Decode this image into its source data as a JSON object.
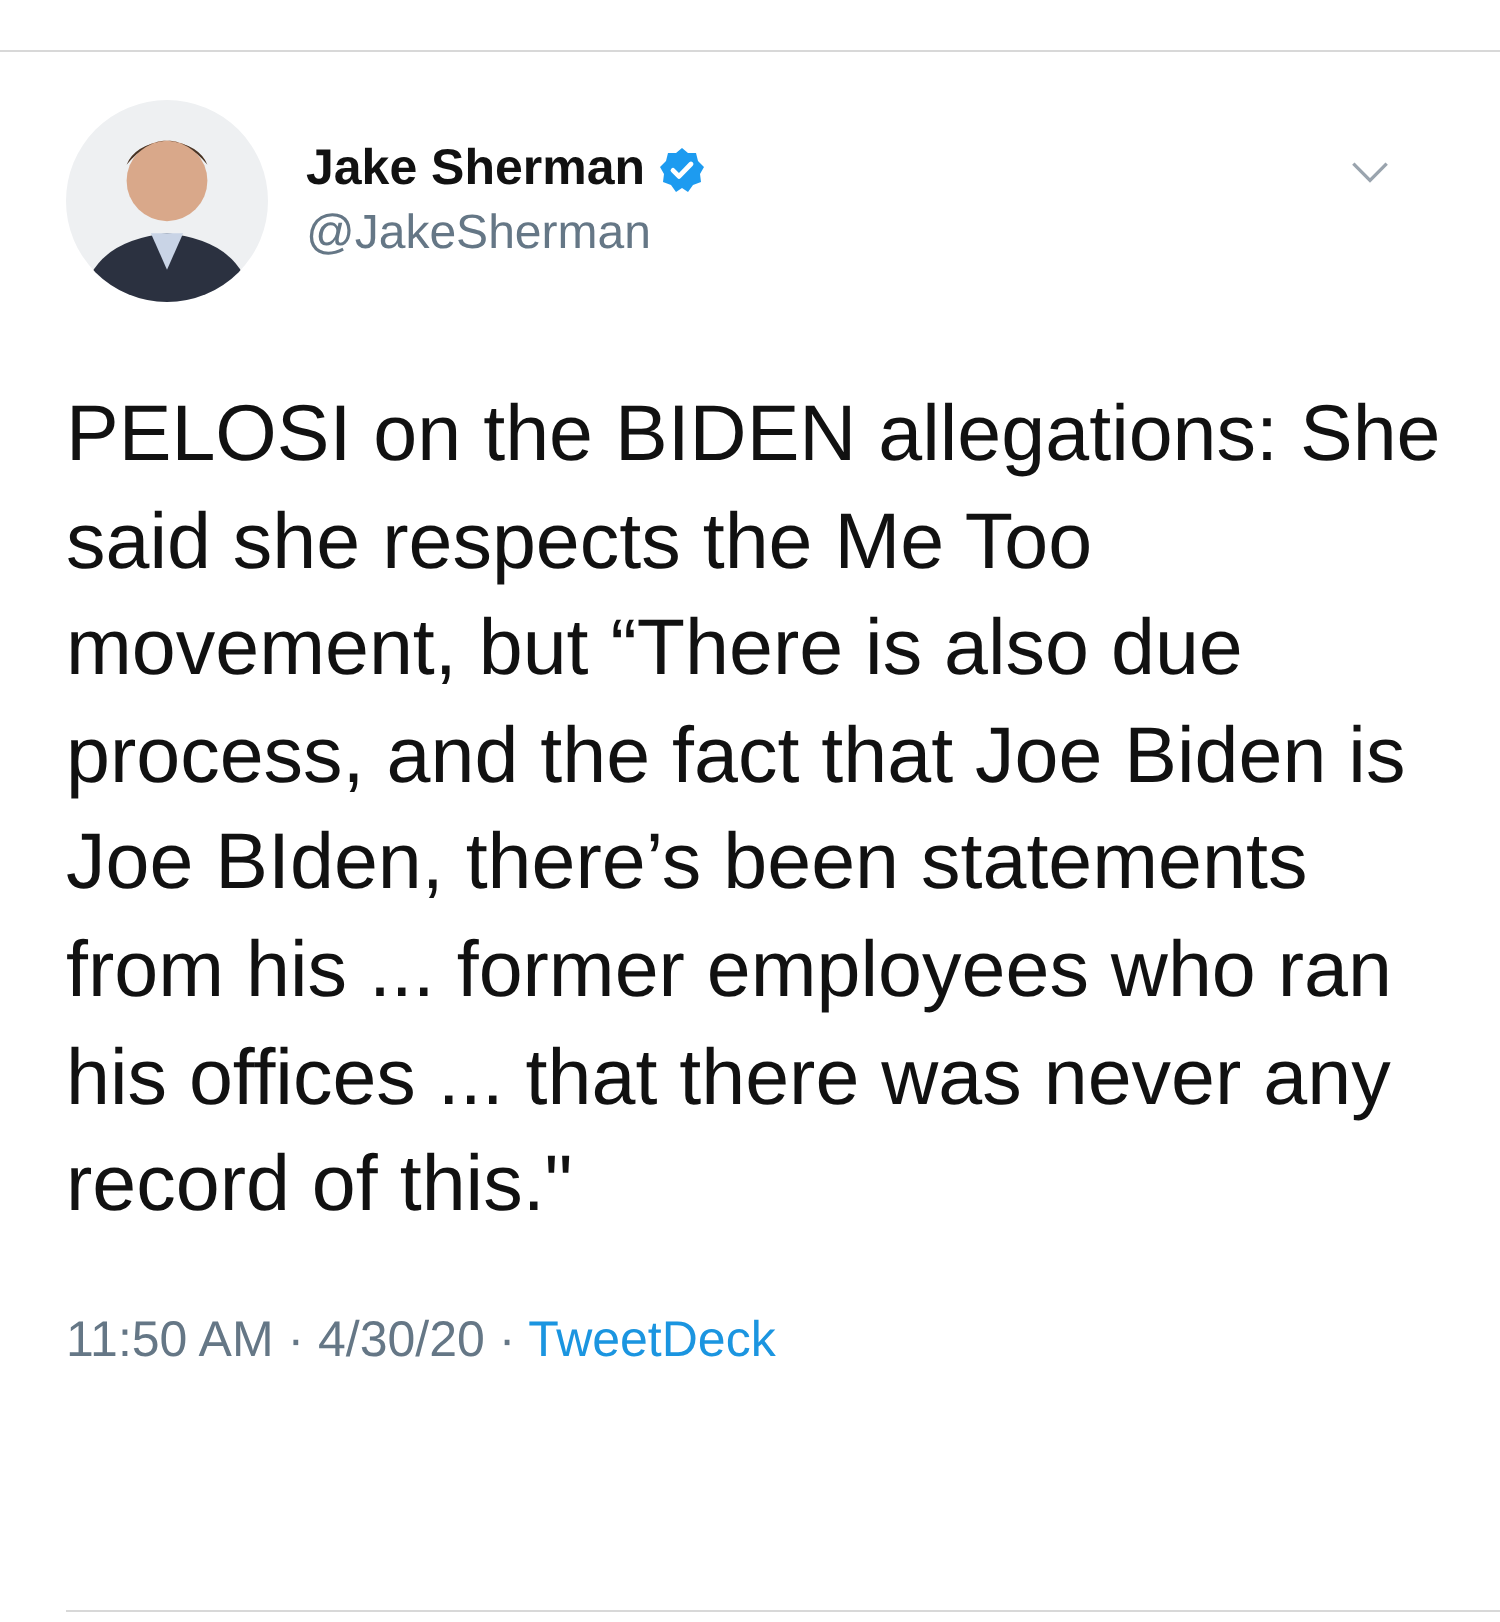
{
  "author": {
    "name": "Jake Sherman",
    "verified": true,
    "handle": "@JakeSherman"
  },
  "text": "PELOSI on the BIDEN allegations: She said she respects the Me Too movement, but “There is also due process, and the fact that Joe Biden is Joe BIden, there’s been statements from his ... former employees who ran his offices ... that there was never any record of this.\"",
  "meta": {
    "time": "11:50 AM",
    "separator_1": "·",
    "date": "4/30/20",
    "separator_2": "·",
    "source": "TweetDeck"
  }
}
